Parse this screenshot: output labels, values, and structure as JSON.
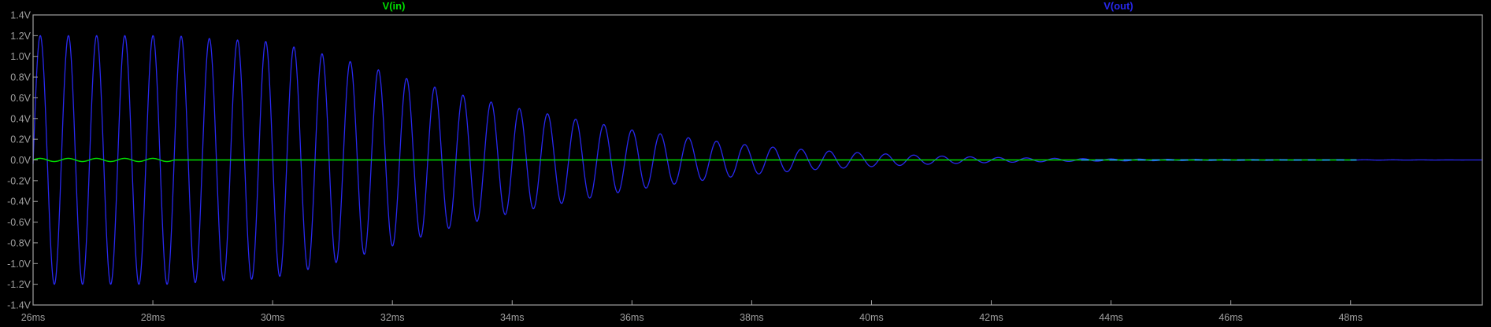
{
  "chart_data": {
    "type": "line",
    "title": "",
    "xlabel": "",
    "ylabel": "",
    "x_unit": "ms",
    "xlim": [
      26,
      50.2
    ],
    "ylim": [
      -1.4,
      1.4
    ],
    "x_ticks": [
      26,
      28,
      30,
      32,
      34,
      36,
      38,
      40,
      42,
      44,
      46,
      48
    ],
    "x_tick_labels": [
      "26ms",
      "28ms",
      "30ms",
      "32ms",
      "34ms",
      "36ms",
      "38ms",
      "40ms",
      "42ms",
      "44ms",
      "46ms",
      "48ms"
    ],
    "y_ticks": [
      1.4,
      1.2,
      1.0,
      0.8,
      0.6,
      0.4,
      0.2,
      0.0,
      -0.2,
      -0.4,
      -0.6,
      -0.8,
      -1.0,
      -1.2,
      -1.4
    ],
    "y_tick_labels": [
      "1.4V",
      "1.2V",
      "1.0V",
      "0.8V",
      "0.6V",
      "0.4V",
      "0.2V",
      "0.0V",
      "-0.2V",
      "-0.4V",
      "-0.6V",
      "-0.8V",
      "-1.0V",
      "-1.2V",
      "-1.4V"
    ],
    "grid": false,
    "legend": "top",
    "series": [
      {
        "name": "V(in)",
        "color": "#00dd00",
        "description_data": {
          "waveform": "small sinusoid",
          "frequency_khz": 2.125,
          "amplitude_v": 0.015,
          "active_until_ms": 28.35,
          "value_after_v": 0.0,
          "x_start": 26.0,
          "x_end": 48.1
        }
      },
      {
        "name": "V(out)",
        "color": "#2828ee",
        "description_data": {
          "waveform": "damped sinusoid",
          "frequency_khz": 2.125,
          "first_peak_ms": 26.12,
          "envelope": [
            [
              26.0,
              1.2
            ],
            [
              28.35,
              1.2
            ],
            [
              29.0,
              1.17
            ],
            [
              30.0,
              1.14
            ],
            [
              31.0,
              1.0
            ],
            [
              32.0,
              0.83
            ],
            [
              33.0,
              0.65
            ],
            [
              34.0,
              0.51
            ],
            [
              35.0,
              0.4
            ],
            [
              36.0,
              0.29
            ],
            [
              37.0,
              0.21
            ],
            [
              38.0,
              0.14
            ],
            [
              39.0,
              0.095
            ],
            [
              40.0,
              0.064
            ],
            [
              41.0,
              0.04
            ],
            [
              42.0,
              0.025
            ],
            [
              43.0,
              0.016
            ],
            [
              44.0,
              0.01
            ],
            [
              45.0,
              0.006
            ],
            [
              46.0,
              0.004
            ],
            [
              48.0,
              0.002
            ],
            [
              50.2,
              0.0
            ]
          ]
        }
      },
      {
        "name": "",
        "color": "#20a0ff",
        "description_data": {
          "waveform": "dashed baseline",
          "start_ms": 43.5,
          "end_ms": 48.1,
          "value_v": 0.0
        }
      }
    ]
  }
}
